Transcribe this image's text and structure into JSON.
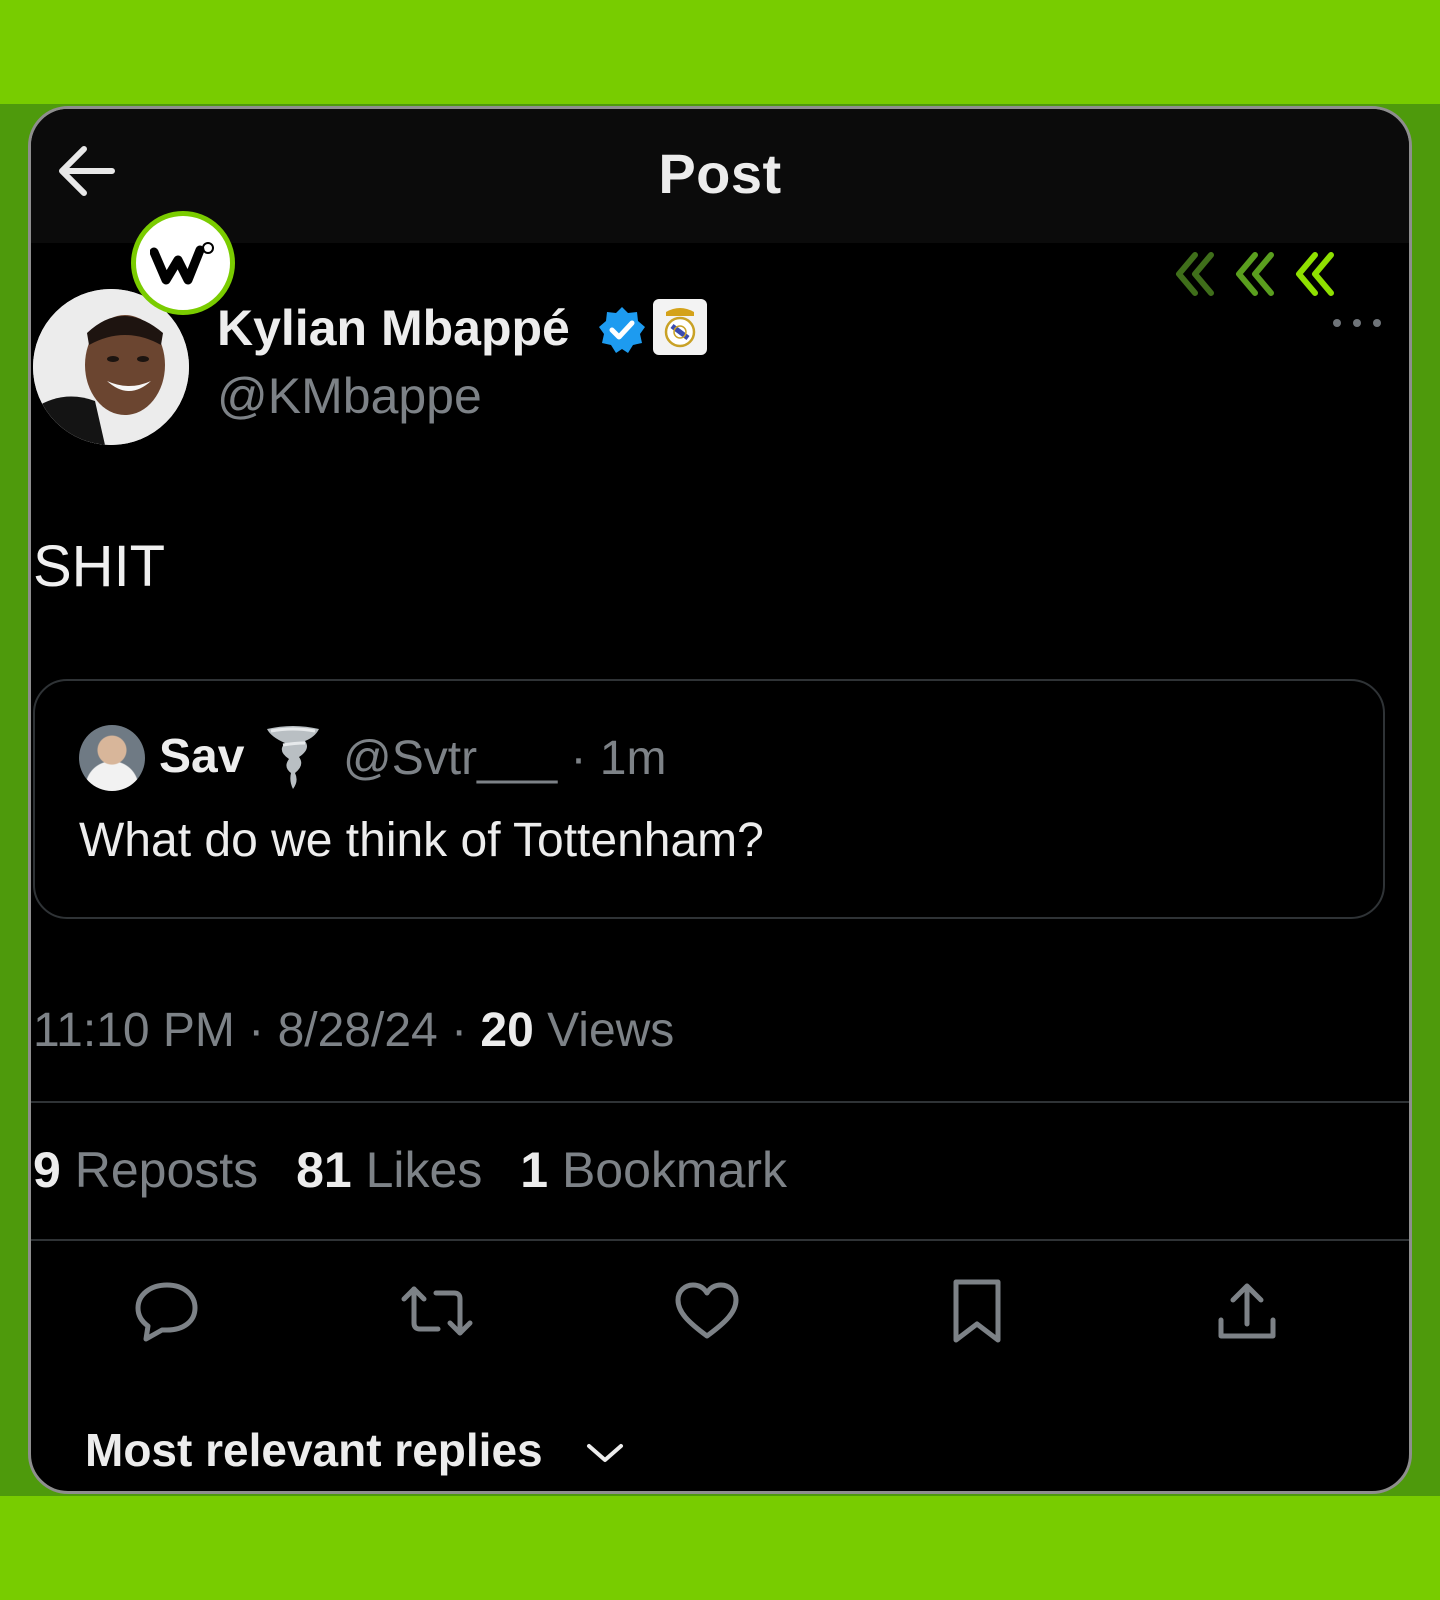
{
  "header": {
    "title": "Post"
  },
  "post": {
    "author_name": "Kylian Mbappé",
    "author_handle": "@KMbappe",
    "text": "SHIT",
    "time": "11:10 PM",
    "date": "8/28/24",
    "views_count": "20",
    "views_label": "Views"
  },
  "quote": {
    "name": "Sav",
    "handle_time": "@Svtr___ · 1m",
    "text": "What do we think of Tottenham?"
  },
  "stats": {
    "reposts_count": "9",
    "reposts_label": "Reposts",
    "likes_count": "81",
    "likes_label": "Likes",
    "bookmarks_count": "1",
    "bookmarks_label": "Bookmark"
  },
  "replies": {
    "sort_label": "Most relevant replies"
  },
  "colors": {
    "accent_green": "#7acc00",
    "verified_blue": "#1d9bf0",
    "muted_text": "#7d8287"
  },
  "icons": [
    "back-arrow-icon",
    "chevrons-icon",
    "verified-badge-icon",
    "club-crest-icon",
    "more-icon",
    "reply-icon",
    "repost-icon",
    "like-icon",
    "bookmark-icon",
    "share-icon",
    "chevron-down-icon",
    "brand-logo-icon",
    "tornado-emoji-icon"
  ]
}
